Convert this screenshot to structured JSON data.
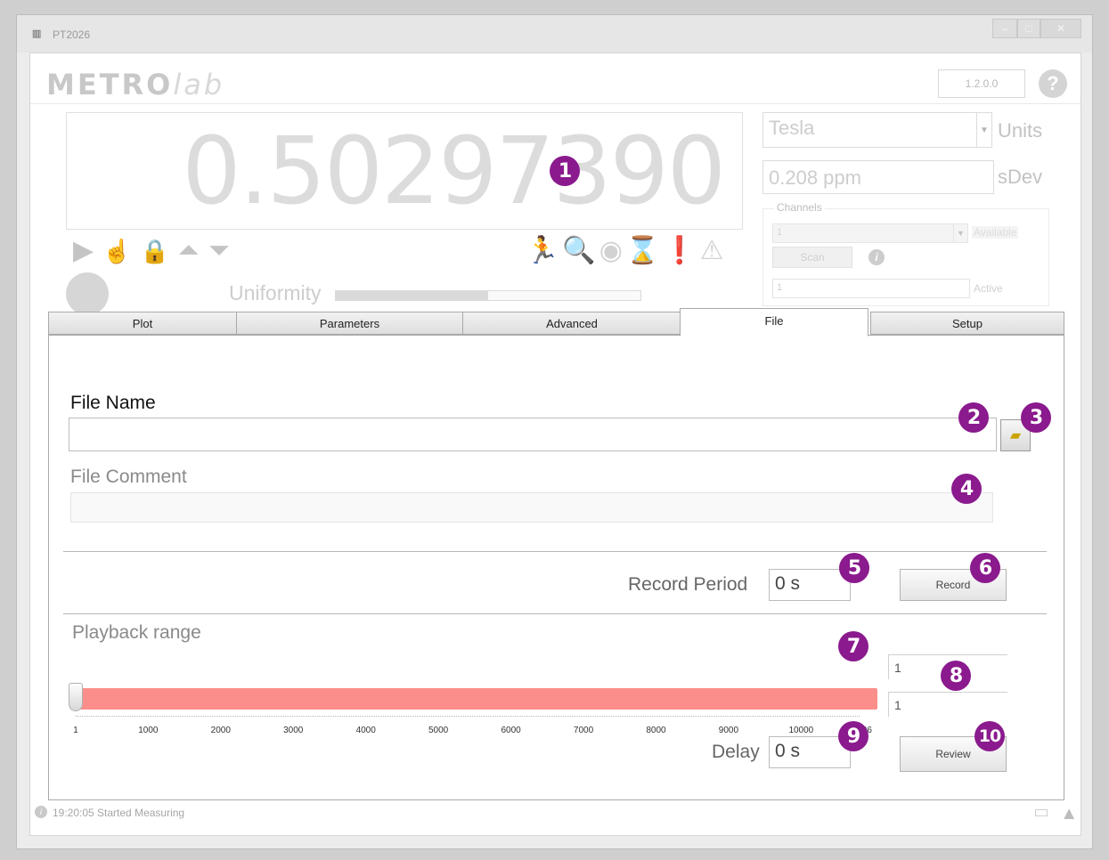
{
  "window": {
    "title": "PT2026",
    "app_icon": "metrolab-m-icon"
  },
  "header": {
    "logo": "METROlab",
    "logo_main": "METRO",
    "logo_lab": "lab",
    "version": "1.2.0.0",
    "help_label": "?"
  },
  "measurement": {
    "value": "0.50297390",
    "uniformity_label": "Uniformity",
    "uniformity_level": 0.5,
    "units": {
      "selected": "Tesla",
      "label": "Units"
    },
    "sdev": {
      "value": "0.208 ppm",
      "label": "sDev"
    },
    "channels": {
      "title": "Channels",
      "available_value": "1",
      "available_label": "Available",
      "scan_label": "Scan",
      "active_value": "1",
      "active_label": "Active"
    }
  },
  "tabs": [
    {
      "label": "Plot"
    },
    {
      "label": "Parameters"
    },
    {
      "label": "Advanced"
    },
    {
      "label": "File",
      "active": true
    },
    {
      "label": "Setup"
    }
  ],
  "file_tab": {
    "file_name_label": "File Name",
    "file_name_value": "",
    "file_comment_label": "File Comment",
    "file_comment_value": "",
    "record_period_label": "Record Period",
    "record_period_value": "0 s",
    "record_button": "Record",
    "playback_label": "Playback range",
    "playback_min": 1,
    "playback_max": 10806,
    "tick_labels": [
      "1",
      "1000",
      "2000",
      "3000",
      "4000",
      "5000",
      "6000",
      "7000",
      "8000",
      "9000",
      "10000",
      "10806"
    ],
    "range_start": "1",
    "range_end": "1",
    "delay_label": "Delay",
    "delay_value": "0 s",
    "review_button": "Review"
  },
  "callouts": [
    "1",
    "2",
    "3",
    "4",
    "5",
    "6",
    "7",
    "8",
    "9",
    "10"
  ],
  "status": {
    "text": "19:20:05 Started Measuring"
  },
  "colors": {
    "callout": "#8a1a8d",
    "playback_range": "#fb8e8b"
  }
}
